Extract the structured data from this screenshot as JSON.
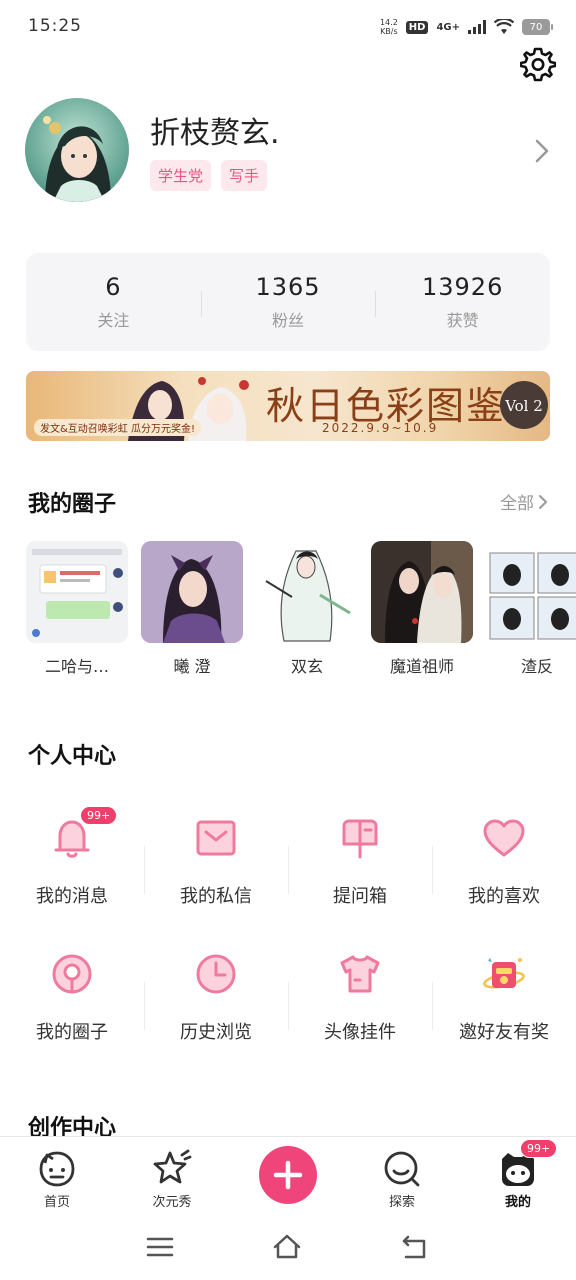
{
  "status": {
    "time": "15:25",
    "net_speed_top": "14.2",
    "net_speed_bottom": "KB/s",
    "hd": "HD",
    "signal": "4G+",
    "battery": "70"
  },
  "profile": {
    "username": "折枝赘玄.",
    "tags": [
      "学生党",
      "写手"
    ]
  },
  "stats": [
    {
      "value": "6",
      "label": "关注"
    },
    {
      "value": "1365",
      "label": "粉丝"
    },
    {
      "value": "13926",
      "label": "获赞"
    }
  ],
  "banner": {
    "title": "秋日色彩图鉴",
    "date": "2022.9.9~10.9",
    "subtitle": "发文&互动召唤彩虹 瓜分万元奖金!",
    "vol": "Vol 2"
  },
  "my_circles": {
    "title": "我的圈子",
    "more": "全部",
    "items": [
      {
        "name": "二哈与…"
      },
      {
        "name": "曦 澄"
      },
      {
        "name": "双玄"
      },
      {
        "name": "魔道祖师"
      },
      {
        "name": "渣反"
      }
    ]
  },
  "personal_center": {
    "title": "个人中心",
    "row1": [
      {
        "label": "我的消息",
        "icon": "bell-icon",
        "badge": "99+"
      },
      {
        "label": "我的私信",
        "icon": "envelope-icon"
      },
      {
        "label": "提问箱",
        "icon": "mailbox-icon"
      },
      {
        "label": "我的喜欢",
        "icon": "heart-icon"
      }
    ],
    "row2": [
      {
        "label": "我的圈子",
        "icon": "circle-pin-icon"
      },
      {
        "label": "历史浏览",
        "icon": "clock-icon"
      },
      {
        "label": "头像挂件",
        "icon": "tshirt-icon"
      },
      {
        "label": "邀好友有奖",
        "icon": "gift-icon"
      }
    ]
  },
  "creation_center": {
    "title": "创作中心"
  },
  "bottom_nav": [
    {
      "label": "首页",
      "icon": "home-cat-icon"
    },
    {
      "label": "次元秀",
      "icon": "star-icon"
    },
    {
      "label": "",
      "icon": "plus-icon"
    },
    {
      "label": "探索",
      "icon": "search-icon"
    },
    {
      "label": "我的",
      "icon": "profile-cat-icon",
      "badge": "99+"
    }
  ],
  "colors": {
    "accent": "#f0457a",
    "tag_bg": "#fde8ee",
    "icon_pink": "#f07a9e"
  }
}
